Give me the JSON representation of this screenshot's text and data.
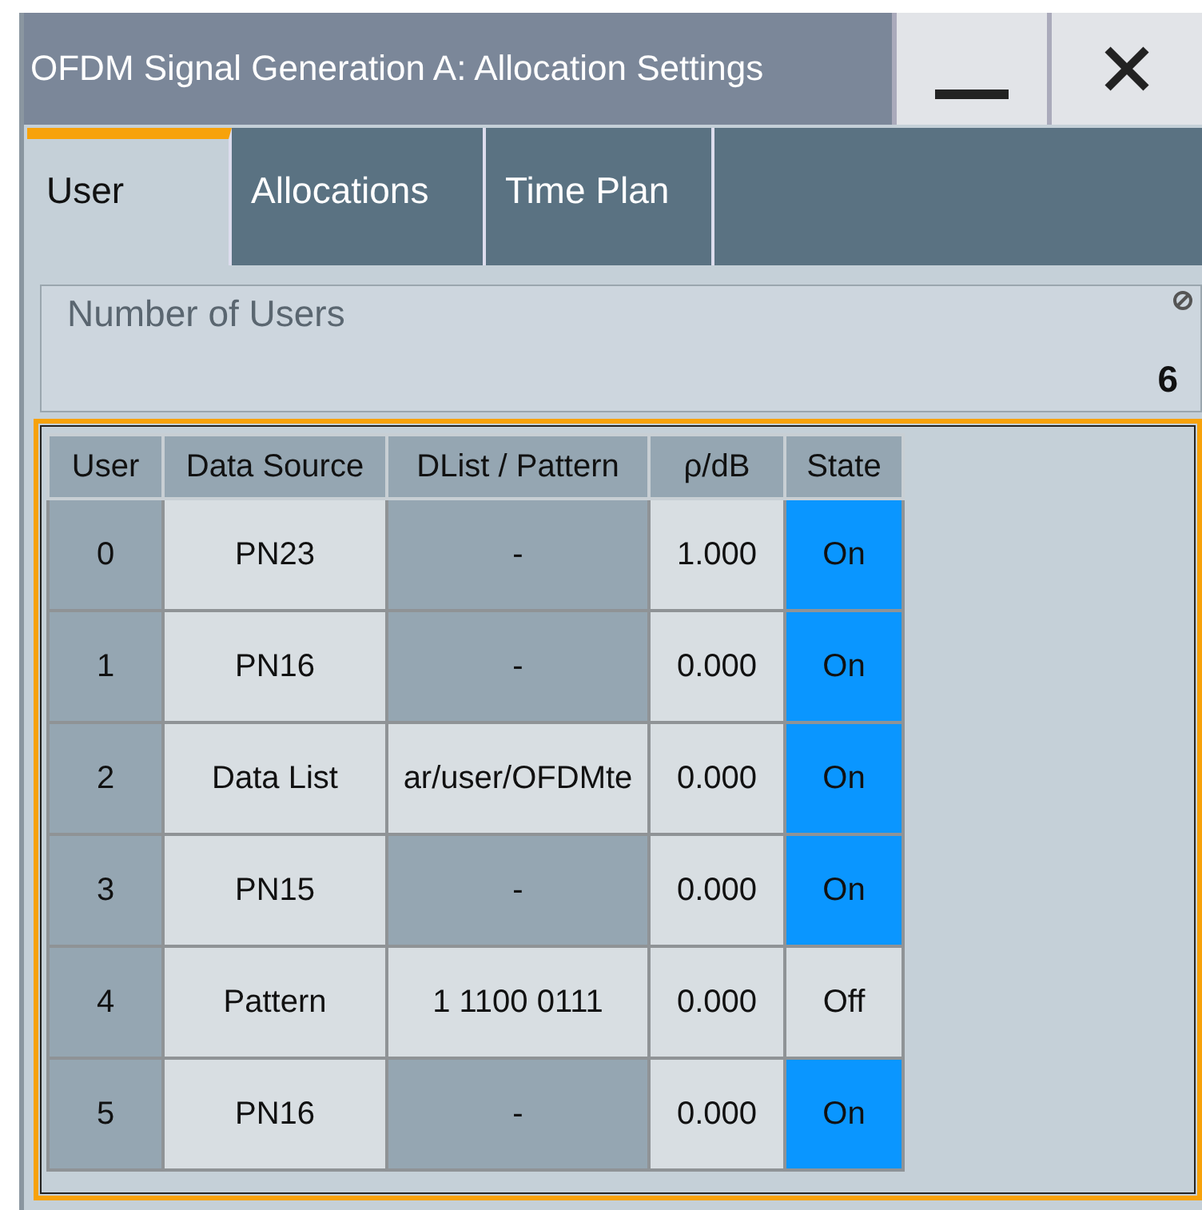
{
  "window": {
    "title": "OFDM Signal Generation A: Allocation Settings"
  },
  "tabs": [
    {
      "label": "User",
      "selected": true
    },
    {
      "label": "Allocations",
      "selected": false
    },
    {
      "label": "Time Plan",
      "selected": false
    }
  ],
  "number_of_users": {
    "label": "Number of Users",
    "value": "6"
  },
  "table": {
    "columns": [
      "User",
      "Data Source",
      "DList / Pattern",
      "ρ/dB",
      "State"
    ],
    "rows": [
      {
        "user": "0",
        "data_source": "PN23",
        "dlist_pattern": "-",
        "dlist_disabled": true,
        "rho_db": "1.000",
        "state": "On",
        "on": true
      },
      {
        "user": "1",
        "data_source": "PN16",
        "dlist_pattern": "-",
        "dlist_disabled": true,
        "rho_db": "0.000",
        "state": "On",
        "on": true
      },
      {
        "user": "2",
        "data_source": "Data List",
        "dlist_pattern": "ar/user/OFDMte",
        "dlist_disabled": false,
        "rho_db": "0.000",
        "state": "On",
        "on": true
      },
      {
        "user": "3",
        "data_source": "PN15",
        "dlist_pattern": "-",
        "dlist_disabled": true,
        "rho_db": "0.000",
        "state": "On",
        "on": true
      },
      {
        "user": "4",
        "data_source": "Pattern",
        "dlist_pattern": "1 1100 0111",
        "dlist_disabled": false,
        "rho_db": "0.000",
        "state": "Off",
        "on": false
      },
      {
        "user": "5",
        "data_source": "PN16",
        "dlist_pattern": "-",
        "dlist_disabled": true,
        "rho_db": "0.000",
        "state": "On",
        "on": true
      }
    ]
  }
}
